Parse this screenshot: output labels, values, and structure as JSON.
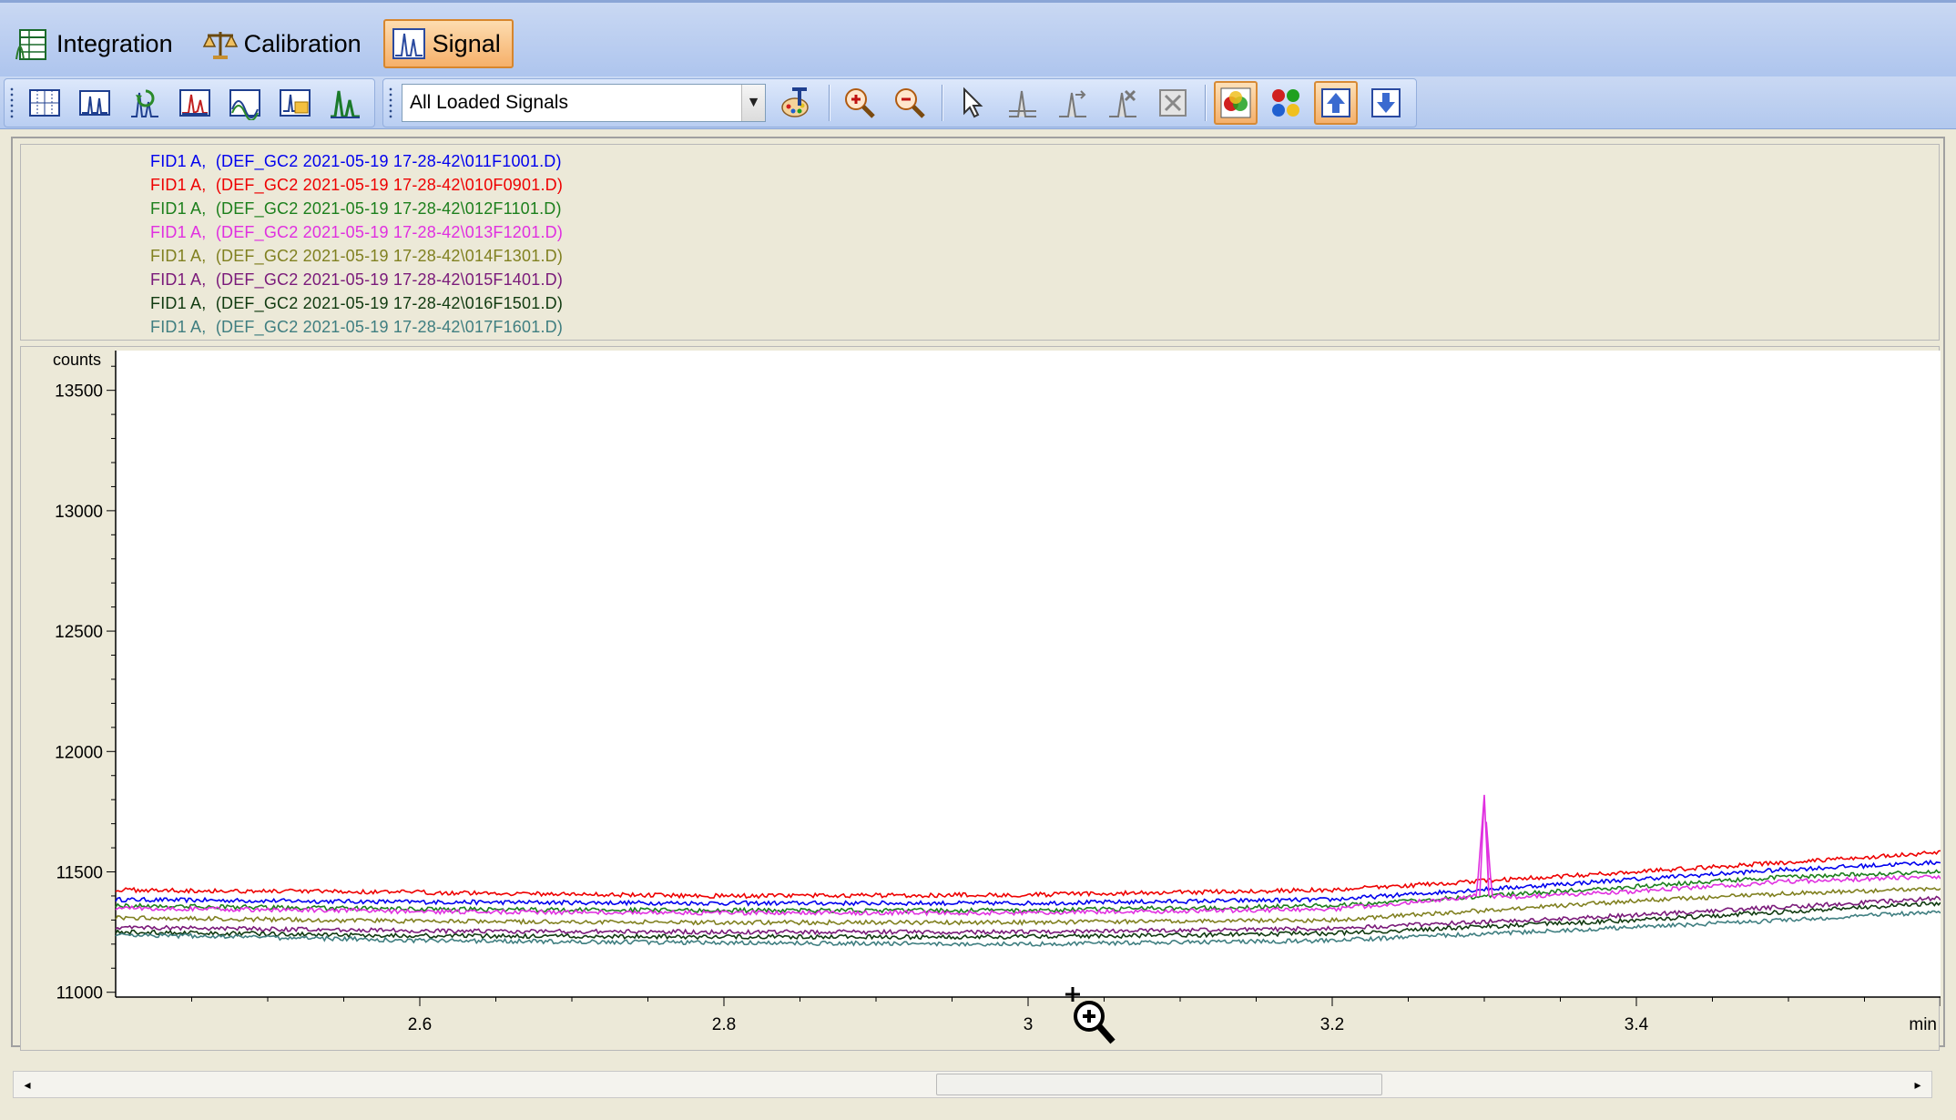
{
  "tabs": [
    {
      "label": "Integration",
      "active": false,
      "icon": "integration-table-icon"
    },
    {
      "label": "Calibration",
      "active": false,
      "icon": "balance-scale-icon"
    },
    {
      "label": "Signal",
      "active": true,
      "icon": "signal-wave-icon"
    }
  ],
  "toolbar": {
    "signal_select": "All Loaded Signals",
    "left_tools": [
      "baseline-grid-icon",
      "peak-window-icon",
      "overlay-refresh-icon",
      "chromatogram-icon",
      "compare-signals-icon",
      "signal-stack-icon",
      "signal-green-icon"
    ],
    "right_tools": [
      "color-palette-icon",
      "zoom-in-icon",
      "zoom-out-icon",
      "select-arrow-icon",
      "add-peak-icon",
      "move-peak-icon",
      "delete-peak-icon",
      "clear-icon",
      "overlay-color-icon",
      "separate-color-icon",
      "move-up-icon",
      "move-down-icon"
    ]
  },
  "legend": [
    {
      "prefix": "FID1 A,",
      "file": "(DEF_GC2 2021-05-19 17-28-42\\011F1001.D)",
      "color": "#0000ee"
    },
    {
      "prefix": "FID1 A,",
      "file": "(DEF_GC2 2021-05-19 17-28-42\\010F0901.D)",
      "color": "#ee0000"
    },
    {
      "prefix": "FID1 A,",
      "file": "(DEF_GC2 2021-05-19 17-28-42\\012F1101.D)",
      "color": "#1c7f1c"
    },
    {
      "prefix": "FID1 A,",
      "file": "(DEF_GC2 2021-05-19 17-28-42\\013F1201.D)",
      "color": "#e030e0"
    },
    {
      "prefix": "FID1 A,",
      "file": "(DEF_GC2 2021-05-19 17-28-42\\014F1301.D)",
      "color": "#808020"
    },
    {
      "prefix": "FID1 A,",
      "file": "(DEF_GC2 2021-05-19 17-28-42\\015F1401.D)",
      "color": "#7a1a7a"
    },
    {
      "prefix": "FID1 A,",
      "file": "(DEF_GC2 2021-05-19 17-28-42\\016F1501.D)",
      "color": "#103a10"
    },
    {
      "prefix": "FID1 A,",
      "file": "(DEF_GC2 2021-05-19 17-28-42\\017F1601.D)",
      "color": "#3f7e80"
    }
  ],
  "chart_data": {
    "type": "line",
    "ylabel": "counts",
    "xlabel": "min",
    "xlim": [
      2.4,
      3.6
    ],
    "ylim": [
      10980,
      13650
    ],
    "xticks": [
      "2.6",
      "2.8",
      "3",
      "3.2",
      "3.4"
    ],
    "yticks": [
      "11000",
      "11500",
      "12000",
      "12500",
      "13000",
      "13500"
    ],
    "series": [
      {
        "name": "011F1001.D",
        "color": "#0000ee",
        "x": [
          2.4,
          2.6,
          2.8,
          3.0,
          3.2,
          3.4,
          3.5,
          3.6
        ],
        "y": [
          11385,
          11375,
          11370,
          11370,
          11385,
          11470,
          11510,
          11540
        ]
      },
      {
        "name": "010F0901.D",
        "color": "#ee0000",
        "x": [
          2.4,
          2.6,
          2.8,
          3.0,
          3.2,
          3.4,
          3.5,
          3.6
        ],
        "y": [
          11425,
          11415,
          11400,
          11405,
          11425,
          11500,
          11540,
          11580
        ]
      },
      {
        "name": "012F1101.D",
        "color": "#1c7f1c",
        "x": [
          2.4,
          2.6,
          2.8,
          3.0,
          3.2,
          3.4,
          3.5,
          3.6
        ],
        "y": [
          11360,
          11345,
          11340,
          11340,
          11360,
          11440,
          11480,
          11500
        ]
      },
      {
        "name": "013F1201.D",
        "color": "#e030e0",
        "x": [
          2.4,
          2.6,
          2.8,
          3.0,
          3.2,
          3.28,
          3.295,
          3.3,
          3.305,
          3.32,
          3.4,
          3.5,
          3.6
        ],
        "y": [
          11350,
          11335,
          11330,
          11330,
          11345,
          11390,
          11400,
          11820,
          11400,
          11395,
          11420,
          11460,
          11480
        ]
      },
      {
        "name": "014F1301.D",
        "color": "#808020",
        "x": [
          2.4,
          2.6,
          2.8,
          3.0,
          3.2,
          3.4,
          3.5,
          3.6
        ],
        "y": [
          11310,
          11295,
          11290,
          11290,
          11300,
          11380,
          11410,
          11430
        ]
      },
      {
        "name": "015F1401.D",
        "color": "#7a1a7a",
        "x": [
          2.4,
          2.6,
          2.8,
          3.0,
          3.2,
          3.4,
          3.5,
          3.6
        ],
        "y": [
          11270,
          11255,
          11250,
          11250,
          11265,
          11320,
          11355,
          11390
        ]
      },
      {
        "name": "016F1501.D",
        "color": "#103a10",
        "x": [
          2.4,
          2.6,
          2.8,
          3.0,
          3.2,
          3.4,
          3.5,
          3.6
        ],
        "y": [
          11250,
          11235,
          11230,
          11230,
          11245,
          11300,
          11335,
          11370
        ]
      },
      {
        "name": "017F1601.D",
        "color": "#3f7e80",
        "x": [
          2.4,
          2.6,
          2.8,
          3.0,
          3.2,
          3.4,
          3.5,
          3.6
        ],
        "y": [
          11240,
          11215,
          11205,
          11200,
          11215,
          11270,
          11300,
          11335
        ]
      }
    ]
  },
  "scrollbar": {
    "left_arrow": "◂",
    "right_arrow": "▸"
  }
}
